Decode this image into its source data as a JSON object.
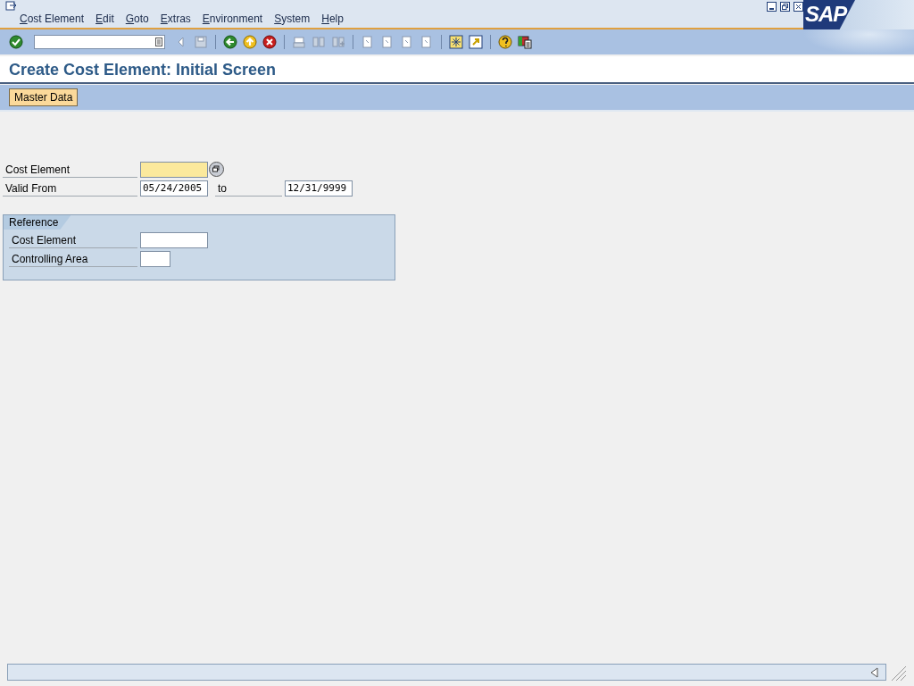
{
  "logo": "SAP",
  "menu": [
    "Cost Element",
    "Edit",
    "Goto",
    "Extras",
    "Environment",
    "System",
    "Help"
  ],
  "title": "Create Cost Element: Initial Screen",
  "app_buttons": [
    "Master Data"
  ],
  "fields": [
    {
      "label": "Cost Element",
      "required": true,
      "value_help": true,
      "kind": "long"
    },
    {
      "label": "Valid From",
      "value": "05/24/2005",
      "required": false,
      "value_help": false,
      "kind": "long",
      "to_label": "to",
      "to_value": "12/31/9999"
    }
  ],
  "reference": {
    "title": "Reference",
    "fields": [
      {
        "label": "Cost Element",
        "required": false,
        "kind": "long"
      },
      {
        "label": "Controlling Area",
        "required": false,
        "kind": "short"
      }
    ]
  }
}
